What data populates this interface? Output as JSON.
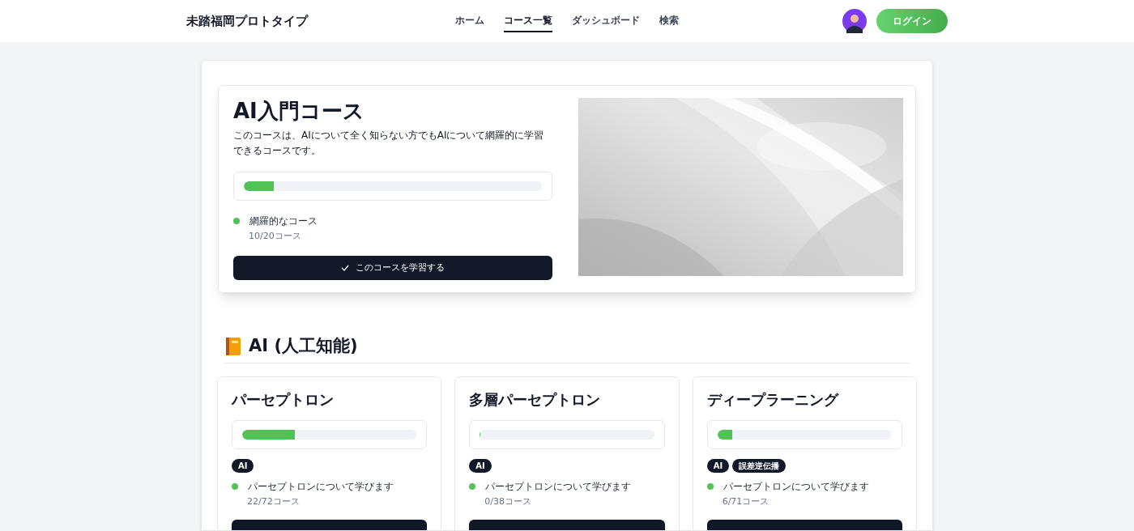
{
  "header": {
    "logo": "未踏福岡プロトタイプ",
    "nav": [
      {
        "label": "ホーム",
        "selected": false
      },
      {
        "label": "コース一覧",
        "selected": true
      },
      {
        "label": "ダッシュボード",
        "selected": false
      },
      {
        "label": "検索"
      }
    ],
    "login": "ログイン"
  },
  "hero": {
    "title": "AI入門コース",
    "description": "このコースは、AIについて全く知らない方でもAIについて網羅的に学習できるコースです。",
    "level": 0.1,
    "status": {
      "label": "網羅的なコース",
      "count": "10/20コース",
      "color": "#51c256"
    },
    "button": "このコースを学習する"
  },
  "section": {
    "title": "AI (人工知能)",
    "courses": [
      {
        "title": "パーセプトロン",
        "level": 0.3,
        "tags": [
          "AI"
        ],
        "status": {
          "label": "パーセプトロンについて学びます",
          "count": "22/72コース",
          "color": "#51c256"
        }
      },
      {
        "title": "多層パーセプトロン",
        "level": 0,
        "tags": [
          "AI"
        ],
        "status": {
          "label": "パーセプトロンについて学びます",
          "count": "0/38コース",
          "color": "#51c256"
        }
      },
      {
        "title": "ディープラーニング",
        "level": 0.085,
        "tags": [
          "AI",
          "誤差逆伝播"
        ],
        "status": {
          "label": "パーセプトロンについて学びます",
          "count": "6/71コース",
          "color": "#51c256"
        }
      }
    ]
  }
}
